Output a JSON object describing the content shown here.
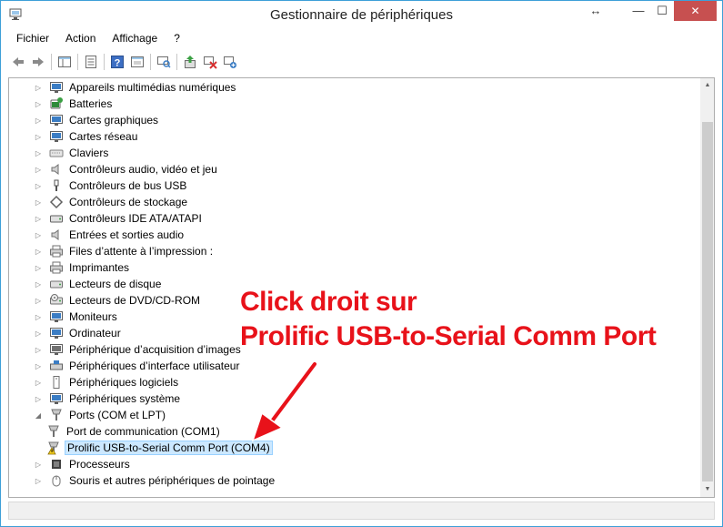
{
  "window": {
    "title": "Gestionnaire de périphériques",
    "resize_glyph": "↔",
    "minimize_glyph": "—",
    "maximize_glyph": "☐",
    "close_glyph": "✕"
  },
  "menu": [
    "Fichier",
    "Action",
    "Affichage",
    "?"
  ],
  "toolbar": {
    "icons": [
      "back-icon",
      "forward-icon",
      "console-tree-icon",
      "properties-icon",
      "help-icon",
      "view-icon",
      "scan-hardware-icon",
      "update-driver-icon",
      "disable-device-icon",
      "uninstall-device-icon"
    ]
  },
  "tree": {
    "items": [
      {
        "label": "Appareils multimédias numériques",
        "icon": "multimedia-icon",
        "expander": "▷",
        "color": "#3b7dc4"
      },
      {
        "label": "Batteries",
        "icon": "battery-icon",
        "expander": "▷",
        "color": "#2e8b3a"
      },
      {
        "label": "Cartes graphiques",
        "icon": "display-adapter-icon",
        "expander": "▷",
        "color": "#3b7dc4"
      },
      {
        "label": "Cartes réseau",
        "icon": "network-adapter-icon",
        "expander": "▷",
        "color": "#3b7dc4"
      },
      {
        "label": "Claviers",
        "icon": "keyboard-icon",
        "expander": "▷",
        "color": "#808080"
      },
      {
        "label": "Contrôleurs audio, vidéo et jeu",
        "icon": "audio-icon",
        "expander": "▷",
        "color": "#707070"
      },
      {
        "label": "Contrôleurs de bus USB",
        "icon": "usb-icon",
        "expander": "▷",
        "color": "#505050"
      },
      {
        "label": "Contrôleurs de stockage",
        "icon": "storage-controller-icon",
        "expander": "▷",
        "color": "#606060"
      },
      {
        "label": "Contrôleurs IDE ATA/ATAPI",
        "icon": "ide-icon",
        "expander": "▷",
        "color": "#606060"
      },
      {
        "label": "Entrées et sorties audio",
        "icon": "speaker-icon",
        "expander": "▷",
        "color": "#707070"
      },
      {
        "label": "Files d’attente à l’impression :",
        "icon": "print-queue-icon",
        "expander": "▷",
        "color": "#707070"
      },
      {
        "label": "Imprimantes",
        "icon": "printer-icon",
        "expander": "▷",
        "color": "#707070"
      },
      {
        "label": "Lecteurs de disque",
        "icon": "disk-drive-icon",
        "expander": "▷",
        "color": "#707070"
      },
      {
        "label": "Lecteurs de DVD/CD-ROM",
        "icon": "dvd-icon",
        "expander": "▷",
        "color": "#707070"
      },
      {
        "label": "Moniteurs",
        "icon": "monitor-icon",
        "expander": "▷",
        "color": "#3b7dc4"
      },
      {
        "label": "Ordinateur",
        "icon": "computer-icon",
        "expander": "▷",
        "color": "#3b7dc4"
      },
      {
        "label": "Périphérique d’acquisition d’images",
        "icon": "imaging-device-icon",
        "expander": "▷",
        "color": "#707070"
      },
      {
        "label": "Périphériques d’interface utilisateur",
        "icon": "hid-icon",
        "expander": "▷",
        "color": "#3b7dc4"
      },
      {
        "label": "Périphériques logiciels",
        "icon": "software-device-icon",
        "expander": "▷",
        "color": "#707070"
      },
      {
        "label": "Périphériques système",
        "icon": "system-device-icon",
        "expander": "▷",
        "color": "#3b7dc4"
      },
      {
        "label": "Ports (COM et LPT)",
        "icon": "port-icon",
        "expander": "◢",
        "color": "#707070"
      },
      {
        "label": "Port de communication (COM1)",
        "icon": "port-icon",
        "expander": "",
        "color": "#707070",
        "child": true
      },
      {
        "label": "Prolific USB-to-Serial Comm Port (COM4)",
        "icon": "port-warning-icon",
        "expander": "",
        "color": "#707070",
        "child": true,
        "selected": true
      },
      {
        "label": "Processeurs",
        "icon": "processor-icon",
        "expander": "▷",
        "color": "#404040"
      },
      {
        "label": "Souris et autres périphériques de pointage",
        "icon": "mouse-icon",
        "expander": "▷",
        "color": "#707070"
      }
    ]
  },
  "scrollbar": {
    "up": "▲",
    "down": "▼"
  },
  "annotation": {
    "line1": "Click droit sur",
    "line2": "Prolific USB-to-Serial Comm Port",
    "color": "#e8121a"
  }
}
